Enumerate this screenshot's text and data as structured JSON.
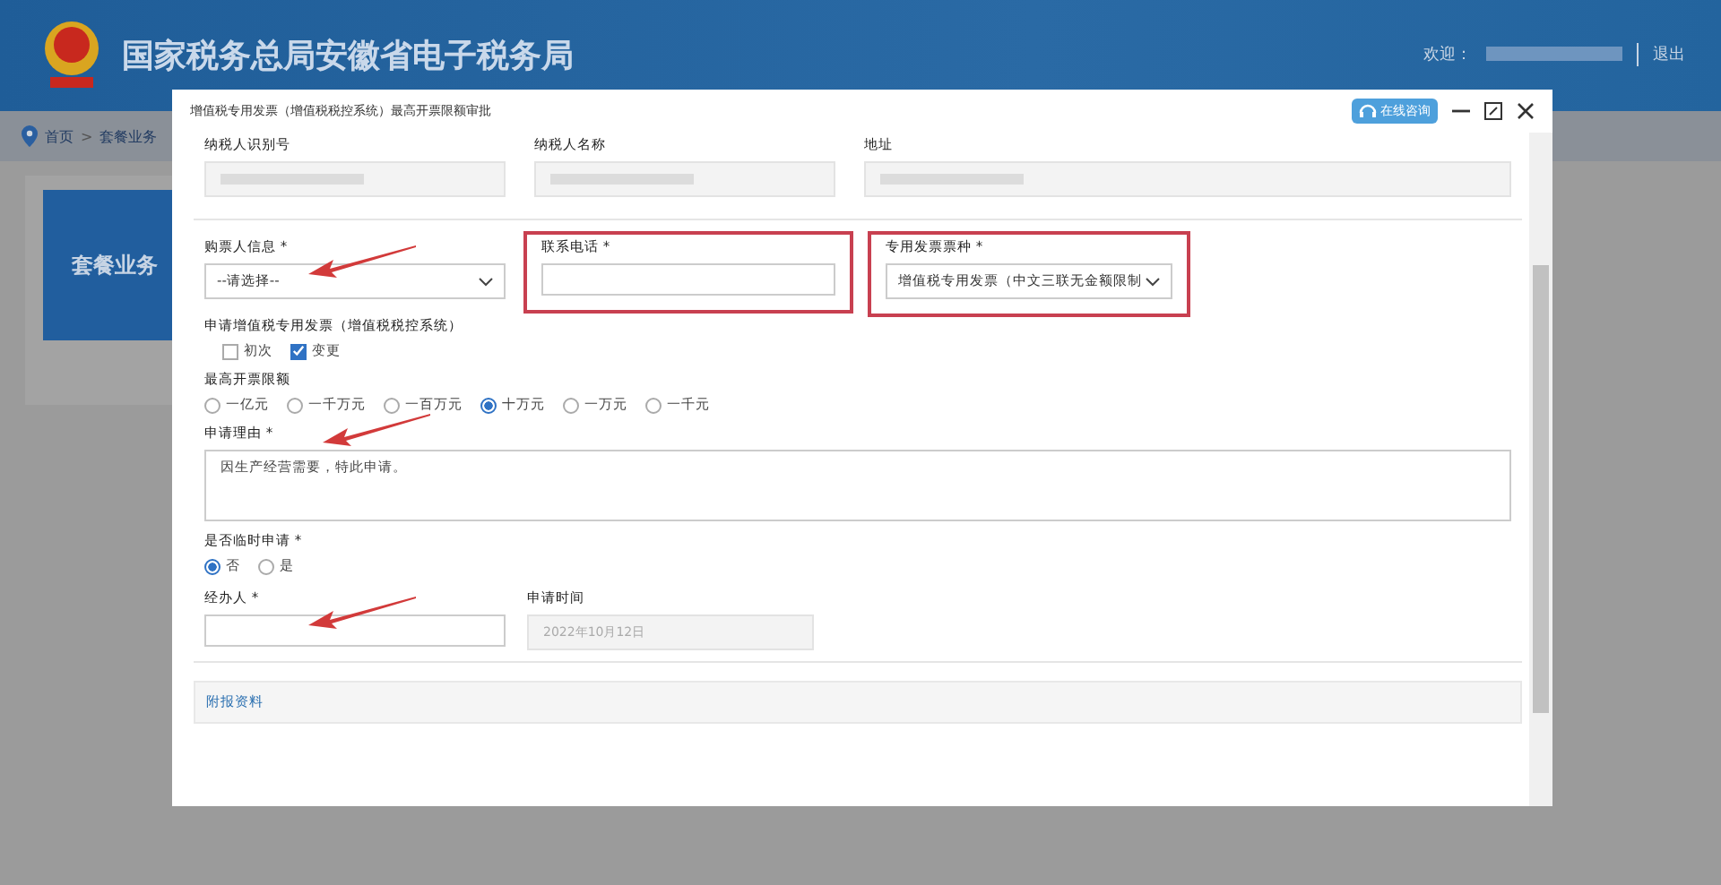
{
  "header": {
    "title": "国家税务总局安徽省电子税务局",
    "welcome": "欢迎：",
    "logout": "退出"
  },
  "breadcrumb": {
    "items": [
      "首页",
      "套餐业务"
    ],
    "separator": ">"
  },
  "card": {
    "label": "套餐业务"
  },
  "dialog": {
    "title": "增值税专用发票（增值税税控系统）最高开票限额审批",
    "help_button": "在线咨询",
    "info_fields": [
      {
        "label": "纳税人识别号"
      },
      {
        "label": "纳税人名称"
      },
      {
        "label": "地址"
      }
    ],
    "buyer": {
      "label": "购票人信息 *",
      "value": "--请选择--",
      "highlighted": false,
      "arrow": true
    },
    "phone": {
      "label": "联系电话 *",
      "highlighted": true
    },
    "invoice_type": {
      "label": "专用发票票种 *",
      "value": "增值税专用发票（中文三联无金额限制",
      "highlighted": true
    },
    "apply_type": {
      "label": "申请增值税专用发票（增值税税控系统）",
      "options": [
        {
          "label": "初次",
          "checked": false
        },
        {
          "label": "变更",
          "checked": true
        }
      ]
    },
    "limit": {
      "label": "最高开票限额",
      "options": [
        {
          "label": "一亿元",
          "selected": false
        },
        {
          "label": "一千万元",
          "selected": false
        },
        {
          "label": "一百万元",
          "selected": false
        },
        {
          "label": "十万元",
          "selected": true
        },
        {
          "label": "一万元",
          "selected": false
        },
        {
          "label": "一千元",
          "selected": false
        }
      ]
    },
    "reason": {
      "label": "申请理由 *",
      "value": "因生产经营需要，特此申请。",
      "highlighted": false,
      "arrow": true
    },
    "temporary": {
      "label": "是否临时申请 *",
      "options": [
        {
          "label": "否",
          "selected": true
        },
        {
          "label": "是",
          "selected": false
        }
      ]
    },
    "handler": {
      "label": "经办人 *",
      "highlighted": false,
      "arrow": true
    },
    "apply_time": {
      "label": "申请时间",
      "value": "2022年10月12日"
    },
    "attachments": {
      "label": "附报资料"
    }
  }
}
